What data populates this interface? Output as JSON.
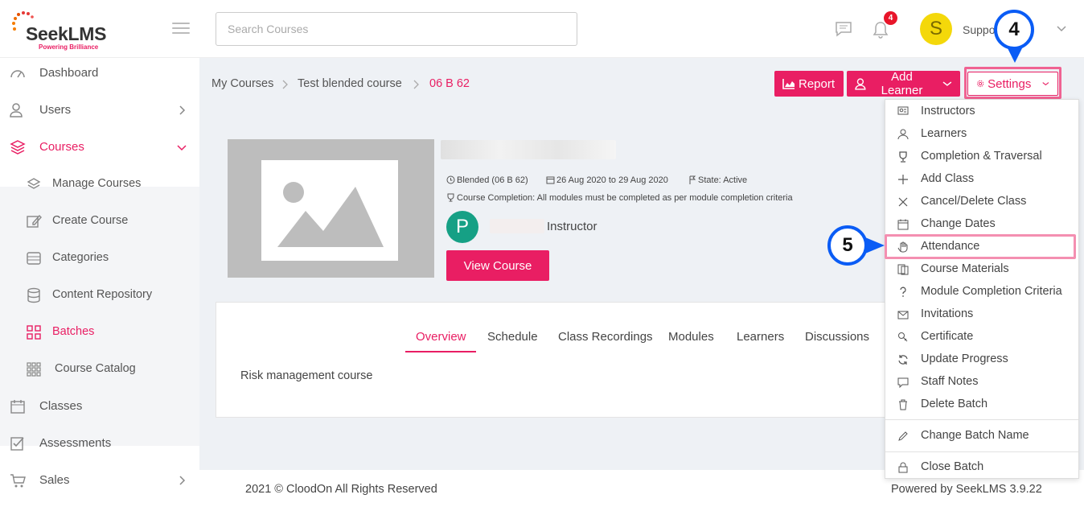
{
  "app": {
    "logo_text": "SeekLMS",
    "logo_tagline": "Powering Brilliance"
  },
  "header": {
    "search_placeholder": "Search Courses",
    "notification_count": "4",
    "avatar_letter": "S",
    "user_name": "Suppo        n"
  },
  "sidebar": {
    "items": [
      {
        "label": "Dashboard",
        "icon": "gauge-icon"
      },
      {
        "label": "Users",
        "icon": "users-icon"
      },
      {
        "label": "Courses",
        "icon": "layers-icon"
      },
      {
        "label": "Manage Courses",
        "icon": "layers-icon"
      },
      {
        "label": "Create Course",
        "icon": "edit-icon"
      },
      {
        "label": "Categories",
        "icon": "categories-icon"
      },
      {
        "label": "Content Repository",
        "icon": "database-icon"
      },
      {
        "label": "Batches",
        "icon": "grid-icon"
      },
      {
        "label": "Course Catalog",
        "icon": "catalog-icon"
      },
      {
        "label": "Classes",
        "icon": "calendar-icon"
      },
      {
        "label": "Assessments",
        "icon": "checkbox-icon"
      },
      {
        "label": "Sales",
        "icon": "cart-icon"
      }
    ]
  },
  "breadcrumb": {
    "items": [
      "My Courses",
      "Test blended course",
      "06 B 62"
    ]
  },
  "actions": {
    "report": "Report",
    "add_learner": "Add Learner",
    "settings": "Settings"
  },
  "course": {
    "type_label": "Blended (06 B 62)",
    "dates": "26 Aug 2020 to 29 Aug 2020",
    "state": "State: Active",
    "completion": "Course Completion: All modules must be completed as per module completion criteria",
    "instructor_initial": "P",
    "instructor_label": "Instructor",
    "view_button": "View Course",
    "description": "Risk management course"
  },
  "tabs": [
    "Overview",
    "Schedule",
    "Class Recordings",
    "Modules",
    "Learners",
    "Discussions"
  ],
  "settings_menu": {
    "items": [
      {
        "label": "Instructors",
        "icon": "instructors-icon"
      },
      {
        "label": "Learners",
        "icon": "learners-icon"
      },
      {
        "label": "Completion & Traversal",
        "icon": "trophy-icon"
      },
      {
        "label": "Add Class",
        "icon": "plus-icon"
      },
      {
        "label": "Cancel/Delete Class",
        "icon": "x-icon"
      },
      {
        "label": "Change Dates",
        "icon": "calendar-icon"
      },
      {
        "label": "Attendance",
        "icon": "hand-icon"
      },
      {
        "label": "Course Materials",
        "icon": "materials-icon"
      },
      {
        "label": "Module Completion Criteria",
        "icon": "question-icon"
      },
      {
        "label": "Invitations",
        "icon": "mail-icon"
      },
      {
        "label": "Certificate",
        "icon": "certificate-icon"
      },
      {
        "label": "Update Progress",
        "icon": "refresh-icon"
      },
      {
        "label": "Staff Notes",
        "icon": "notes-icon"
      },
      {
        "label": "Delete Batch",
        "icon": "trash-icon"
      },
      {
        "label": "Change Batch Name",
        "icon": "pencil-icon"
      },
      {
        "label": "Close Batch",
        "icon": "lock-icon"
      }
    ]
  },
  "steps": {
    "step4": "4",
    "step5": "5"
  },
  "footer": {
    "copyright": "2021 © CloodOn All Rights Reserved",
    "powered": "Powered by SeekLMS 3.9.22"
  },
  "colors": {
    "accent": "#e91e63",
    "step_ring": "#0a5cf5",
    "highlight": "#f06292"
  }
}
